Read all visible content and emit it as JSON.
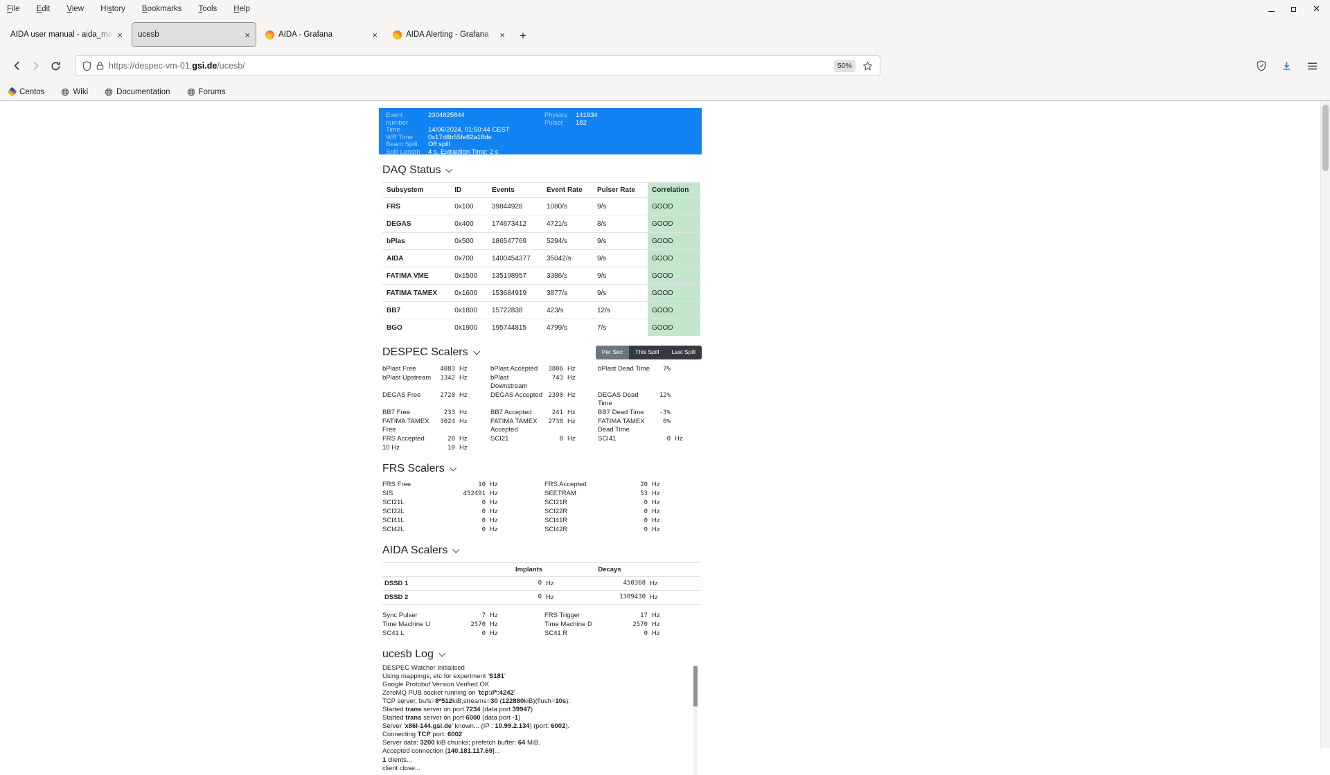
{
  "colors": {
    "accent_blue": "#1283f2",
    "info_label_blue": "#a9d2f7",
    "good_green_bg": "#c3e6cb",
    "button_active_gray": "#6c757d",
    "button_dark_gray": "#343a40",
    "download_icon_blue": "#2e7cd6"
  },
  "browser": {
    "menu": [
      {
        "label": "File",
        "accel": 0
      },
      {
        "label": "Edit",
        "accel": 0
      },
      {
        "label": "View",
        "accel": 0
      },
      {
        "label": "History",
        "accel": 2
      },
      {
        "label": "Bookmarks",
        "accel": 0
      },
      {
        "label": "Tools",
        "accel": 0
      },
      {
        "label": "Help",
        "accel": 0
      }
    ],
    "tabs": [
      {
        "title": "AIDA user manual - aida_man",
        "icon": "none",
        "active": false
      },
      {
        "title": "ucesb",
        "icon": "none",
        "active": true
      },
      {
        "title": "AIDA - Grafana",
        "icon": "grafana",
        "active": false
      },
      {
        "title": "AIDA Alerting - Grafana",
        "icon": "grafana",
        "active": false
      }
    ],
    "new_tab_label": "+",
    "url": {
      "scheme_sub": "https://despec-vm-01.",
      "domain": "gsi.de",
      "path": "/ucesb/"
    },
    "zoom_badge": "50%",
    "bookmarks": [
      {
        "label": "Centos",
        "icon": "centos"
      },
      {
        "label": "Wiki",
        "icon": "globe"
      },
      {
        "label": "Documentation",
        "icon": "globe"
      },
      {
        "label": "Forums",
        "icon": "globe"
      }
    ]
  },
  "page": {
    "info_box": {
      "left": [
        [
          "Event number",
          "2304825844"
        ],
        [
          "Time",
          "14/06/2024, 01:50:44 CEST"
        ],
        [
          "WR Time",
          "0x17d8b55fe82a18de"
        ],
        [
          "Beam Spill",
          "Off spill"
        ],
        [
          "Spill Length",
          "4 s, Extraction Time: 2 s"
        ]
      ],
      "right": [
        [
          "Physics",
          "141934"
        ],
        [
          "Pulser",
          "182"
        ]
      ]
    },
    "daq": {
      "title": "DAQ Status",
      "columns": [
        "Subsystem",
        "ID",
        "Events",
        "Event Rate",
        "Pulser Rate",
        "Correlation"
      ],
      "rows": [
        [
          "FRS",
          "0x100",
          "39844928",
          "1080/s",
          "9/s",
          "GOOD"
        ],
        [
          "DEGAS",
          "0x400",
          "174673412",
          "4721/s",
          "8/s",
          "GOOD"
        ],
        [
          "bPlas",
          "0x500",
          "186547769",
          "5294/s",
          "9/s",
          "GOOD"
        ],
        [
          "AIDA",
          "0x700",
          "1400454377",
          "35042/s",
          "9/s",
          "GOOD"
        ],
        [
          "FATIMA VME",
          "0x1500",
          "135198957",
          "3386/s",
          "9/s",
          "GOOD"
        ],
        [
          "FATIMA TAMEX",
          "0x1600",
          "153684919",
          "3877/s",
          "9/s",
          "GOOD"
        ],
        [
          "BB7",
          "0x1800",
          "15722838",
          "423/s",
          "12/s",
          "GOOD"
        ],
        [
          "BGO",
          "0x1900",
          "195744815",
          "4799/s",
          "7/s",
          "GOOD"
        ]
      ]
    },
    "despec": {
      "title": "DESPEC Scalers",
      "buttons": [
        {
          "label": "Per Sec",
          "active": true
        },
        {
          "label": "This Spill",
          "active": false
        },
        {
          "label": "Last Spill",
          "active": false
        }
      ],
      "grid": [
        [
          {
            "l": "bPlast Free",
            "v": "4083",
            "u": "Hz"
          },
          {
            "l": "bPlast Accepted",
            "v": "3806",
            "u": "Hz"
          },
          {
            "l": "bPlast Dead Time",
            "v": "7%",
            "u": ""
          }
        ],
        [
          {
            "l": "bPlast Upstream",
            "v": "3342",
            "u": "Hz"
          },
          {
            "l": "bPlast\nDownstream",
            "v": "743",
            "u": "Hz"
          },
          null
        ],
        [
          {
            "l": "DEGAS Free",
            "v": "2720",
            "u": "Hz"
          },
          {
            "l": "DEGAS Accepted",
            "v": "2390",
            "u": "Hz"
          },
          {
            "l": "DEGAS Dead\nTime",
            "v": "12%",
            "u": ""
          }
        ],
        [
          {
            "l": "BB7 Free",
            "v": "233",
            "u": "Hz"
          },
          {
            "l": "BB7 Accepted",
            "v": "241",
            "u": "Hz"
          },
          {
            "l": "BB7 Dead Time",
            "v": "-3%",
            "u": ""
          }
        ],
        [
          {
            "l": "FATIMA TAMEX\nFree",
            "v": "3024",
            "u": "Hz"
          },
          {
            "l": "FATIMA TAMEX\nAccepted",
            "v": "2738",
            "u": "Hz"
          },
          {
            "l": "FATIMA TAMEX\nDead Time",
            "v": "0%",
            "u": ""
          }
        ],
        [
          {
            "l": "FRS Accepted",
            "v": "20",
            "u": "Hz"
          },
          {
            "l": "SCI21",
            "v": "0",
            "u": "Hz"
          },
          {
            "l": "SCI41",
            "v": "0",
            "u": "Hz"
          }
        ],
        [
          {
            "l": "10 Hz",
            "v": "10",
            "u": "Hz"
          },
          null,
          null
        ]
      ]
    },
    "frs": {
      "title": "FRS Scalers",
      "grid": [
        [
          {
            "l": "FRS Free",
            "v": "10",
            "u": "Hz"
          },
          {
            "l": "FRS Accepted",
            "v": "20",
            "u": "Hz"
          }
        ],
        [
          {
            "l": "SIS",
            "v": "452491",
            "u": "Hz"
          },
          {
            "l": "SEETRAM",
            "v": "53",
            "u": "Hz"
          }
        ],
        [
          {
            "l": "SCI21L",
            "v": "0",
            "u": "Hz"
          },
          {
            "l": "SCI21R",
            "v": "0",
            "u": "Hz"
          }
        ],
        [
          {
            "l": "SCI22L",
            "v": "0",
            "u": "Hz"
          },
          {
            "l": "SCI22R",
            "v": "0",
            "u": "Hz"
          }
        ],
        [
          {
            "l": "SCI41L",
            "v": "0",
            "u": "Hz"
          },
          {
            "l": "SCI41R",
            "v": "0",
            "u": "Hz"
          }
        ],
        [
          {
            "l": "SCI42L",
            "v": "0",
            "u": "Hz"
          },
          {
            "l": "SCI42R",
            "v": "0",
            "u": "Hz"
          }
        ]
      ]
    },
    "aida": {
      "title": "AIDA Scalers",
      "col_implants": "Implants",
      "col_decays": "Decays",
      "unit": "Hz",
      "rows": [
        {
          "name": "DSSD 1",
          "implants": "0",
          "decays": "458368"
        },
        {
          "name": "DSSD 2",
          "implants": "0",
          "decays": "1309430"
        }
      ],
      "grid": [
        [
          {
            "l": "Sync Pulser",
            "v": "7",
            "u": "Hz"
          },
          {
            "l": "FRS Trigger",
            "v": "17",
            "u": "Hz"
          }
        ],
        [
          {
            "l": "Time Machine U",
            "v": "2570",
            "u": "Hz"
          },
          {
            "l": "Time Machine D",
            "v": "2570",
            "u": "Hz"
          }
        ],
        [
          {
            "l": "SC41 L",
            "v": "0",
            "u": "Hz"
          },
          {
            "l": "SC41 R",
            "v": "0",
            "u": "Hz"
          }
        ]
      ]
    },
    "log": {
      "title": "ucesb Log",
      "lines": [
        [
          [
            "DESPEC Watcher Initialised",
            0
          ]
        ],
        [
          [
            "Using mappings, etc for experiment '",
            0
          ],
          [
            "S181",
            1
          ],
          [
            "'",
            0
          ]
        ],
        [
          [
            "Google Protobuf Version Verified OK",
            0
          ]
        ],
        [
          [
            "ZeroMQ PUB socket running on '",
            0
          ],
          [
            "tcp://*:4242",
            1
          ],
          [
            "'",
            0
          ]
        ],
        [
          [
            "TCP server, bufs=",
            0
          ],
          [
            "8*512",
            1
          ],
          [
            "kiB,streams=",
            0
          ],
          [
            "30",
            1
          ],
          [
            " (",
            0
          ],
          [
            "122880",
            1
          ],
          [
            "kiB)(flush=",
            0
          ],
          [
            "10s",
            1
          ],
          [
            "):",
            0
          ]
        ],
        [
          [
            "Started ",
            0
          ],
          [
            "trans",
            1
          ],
          [
            " server on port ",
            0
          ],
          [
            "7234",
            1
          ],
          [
            " (data port ",
            0
          ],
          [
            "39947",
            1
          ],
          [
            ")",
            0
          ]
        ],
        [
          [
            "Started ",
            0
          ],
          [
            "trans",
            1
          ],
          [
            " server on port ",
            0
          ],
          [
            "6000",
            1
          ],
          [
            " (data port ",
            0
          ],
          [
            "-1",
            1
          ],
          [
            ")",
            0
          ]
        ],
        [
          [
            "Server '",
            0
          ],
          [
            "x86l-144.gsi.de",
            1
          ],
          [
            "' known... (IP : ",
            0
          ],
          [
            "10.99.2.134",
            1
          ],
          [
            ") (port: ",
            0
          ],
          [
            "6002",
            1
          ],
          [
            ").",
            0
          ]
        ],
        [
          [
            "Connecting ",
            0
          ],
          [
            "TCP",
            1
          ],
          [
            " port: ",
            0
          ],
          [
            "6002",
            1
          ]
        ],
        [
          [
            "Server data: ",
            0
          ],
          [
            "3200",
            1
          ],
          [
            " kiB chunks; prefetch buffer: ",
            0
          ],
          [
            "64",
            1
          ],
          [
            " MiB.",
            0
          ]
        ],
        [
          [
            "Accepted connection [",
            0
          ],
          [
            "140.181.117.69",
            1
          ],
          [
            "]...",
            0
          ]
        ],
        [
          [
            "1",
            1
          ],
          [
            " clients...",
            0
          ]
        ],
        [
          [
            "client close...",
            0
          ]
        ]
      ]
    }
  }
}
